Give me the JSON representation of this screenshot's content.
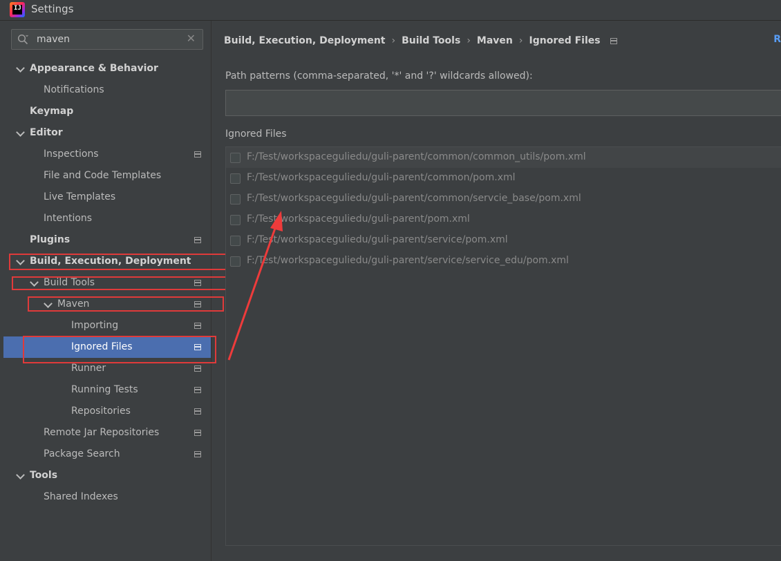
{
  "window": {
    "title": "Settings",
    "app_icon": "intellij-idea-icon"
  },
  "search": {
    "value": "maven"
  },
  "tree": [
    {
      "label": "Appearance & Behavior",
      "bold": true,
      "level": 0,
      "expanded": true
    },
    {
      "label": "Notifications",
      "bold": false,
      "level": 1
    },
    {
      "label": "Keymap",
      "bold": true,
      "level": 0
    },
    {
      "label": "Editor",
      "bold": true,
      "level": 0,
      "expanded": true
    },
    {
      "label": "Inspections",
      "bold": false,
      "level": 1,
      "icon": true
    },
    {
      "label": "File and Code Templates",
      "bold": false,
      "level": 1
    },
    {
      "label": "Live Templates",
      "bold": false,
      "level": 1
    },
    {
      "label": "Intentions",
      "bold": false,
      "level": 1
    },
    {
      "label": "Plugins",
      "bold": true,
      "level": 0,
      "icon": true
    },
    {
      "label": "Build,  Execution,  Deployment",
      "bold": true,
      "level": 0,
      "expanded": true
    },
    {
      "label": "Build Tools",
      "bold": false,
      "level": 1,
      "expanded": true,
      "icon": true
    },
    {
      "label": "Maven",
      "bold": false,
      "level": 2,
      "expanded": true,
      "icon": true
    },
    {
      "label": "Importing",
      "bold": false,
      "level": 3,
      "icon": true
    },
    {
      "label": "Ignored Files",
      "bold": false,
      "level": 3,
      "icon": true,
      "selected": true
    },
    {
      "label": "Runner",
      "bold": false,
      "level": 3,
      "icon": true
    },
    {
      "label": "Running Tests",
      "bold": false,
      "level": 3,
      "icon": true
    },
    {
      "label": "Repositories",
      "bold": false,
      "level": 3,
      "icon": true
    },
    {
      "label": "Remote Jar Repositories",
      "bold": false,
      "level": 1,
      "icon": true
    },
    {
      "label": "Package Search",
      "bold": false,
      "level": 1,
      "icon": true
    },
    {
      "label": "Tools",
      "bold": true,
      "level": 0,
      "expanded": true
    },
    {
      "label": "Shared Indexes",
      "bold": false,
      "level": 1
    }
  ],
  "breadcrumb": [
    "Build,  Execution,  Deployment",
    "Build Tools",
    "Maven",
    "Ignored Files"
  ],
  "reset_label": "R",
  "path_patterns": {
    "label": "Path patterns (comma-separated, '*' and '?' wildcards allowed):",
    "value": ""
  },
  "ignored_files": {
    "label": "Ignored Files",
    "items": [
      {
        "path": "F:/Test/workspaceguliedu/guli-parent/common/common_utils/pom.xml",
        "checked": false
      },
      {
        "path": "F:/Test/workspaceguliedu/guli-parent/common/pom.xml",
        "checked": false
      },
      {
        "path": "F:/Test/workspaceguliedu/guli-parent/common/servcie_base/pom.xml",
        "checked": false
      },
      {
        "path": "F:/Test/workspaceguliedu/guli-parent/pom.xml",
        "checked": false
      },
      {
        "path": "F:/Test/workspaceguliedu/guli-parent/service/pom.xml",
        "checked": false
      },
      {
        "path": "F:/Test/workspaceguliedu/guli-parent/service/service_edu/pom.xml",
        "checked": false
      }
    ]
  },
  "colors": {
    "background": "#3c3f41",
    "selection": "#4b6eaf",
    "annotation": "#e03a3a",
    "link": "#589df6"
  }
}
